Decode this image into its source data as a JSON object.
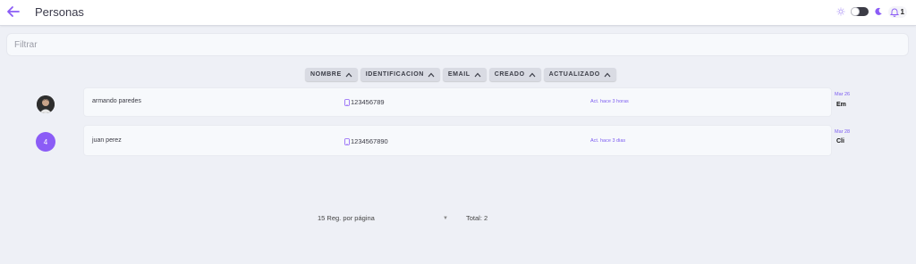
{
  "header": {
    "title": "Personas",
    "notifications_count": "1",
    "theme_toggle": {
      "dark": false
    },
    "colors": {
      "accent": "#8b5cf6"
    }
  },
  "filter": {
    "placeholder": "Filtrar",
    "value": ""
  },
  "sort_buttons": [
    {
      "label": "NOMBRE",
      "icon": "chevron-up-icon"
    },
    {
      "label": "IDENTIFICACION",
      "icon": "chevron-up-icon"
    },
    {
      "label": "EMAIL",
      "icon": "chevron-up-icon"
    },
    {
      "label": "CREADO",
      "icon": "chevron-up-icon"
    },
    {
      "label": "ACTUALIZADO",
      "icon": "chevron-up-icon"
    }
  ],
  "rows": [
    {
      "avatar": "photo",
      "name": "armando paredes",
      "identification": "123456789",
      "updated": "Act. hace 3 horas",
      "date": "Mar 26",
      "code": "Em"
    },
    {
      "avatar": "4",
      "name": "juan perez",
      "identification": "1234567890",
      "updated": "Act. hace 3 dias",
      "date": "Mar 28",
      "code": "Cli"
    }
  ],
  "pagination": {
    "per_page_label": "15 Reg. por página",
    "total_label": "Total: 2"
  }
}
